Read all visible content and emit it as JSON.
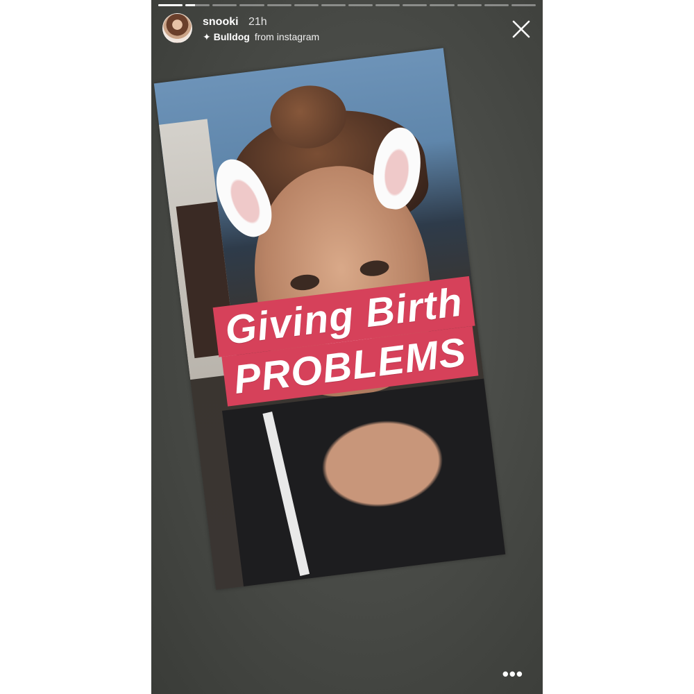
{
  "story": {
    "progress": {
      "segment_count": 14,
      "active_segment_index": 1,
      "active_segment_progress": 0.4
    },
    "header": {
      "username": "snooki",
      "timestamp": "21h",
      "filter_name": "Bulldog",
      "filter_source": "from instagram",
      "avatar_icon": "profile-avatar",
      "sparkle_icon": "sparkle-icon",
      "close_icon": "close-icon"
    },
    "caption": {
      "line1": "Giving Birth",
      "line2": "PROBLEMS",
      "highlight_color": "#d6415a"
    },
    "footer": {
      "more_label": "•••"
    }
  }
}
